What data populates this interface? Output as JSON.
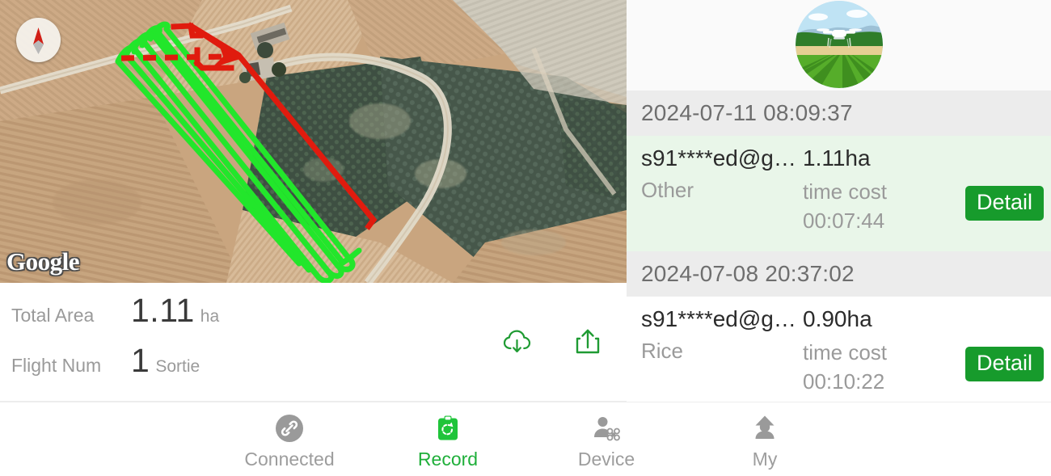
{
  "map": {
    "provider_logo": "Google",
    "compass_icon": "compass-needle-icon",
    "flight_path_color": "#22e62b",
    "boundary_color": "#e01b0e"
  },
  "summary": {
    "rows": [
      {
        "label": "Total Area",
        "value": "1.11",
        "unit": "ha"
      },
      {
        "label": "Flight Num",
        "value": "1",
        "unit": "Sortie"
      }
    ],
    "actions": [
      {
        "name": "cloud-download-icon",
        "label": "Download"
      },
      {
        "name": "share-upload-icon",
        "label": "Upload"
      }
    ],
    "action_color": "#1f9b33"
  },
  "records": {
    "avatar_icon": "drone-over-farmland-avatar",
    "items": [
      {
        "date": "2024-07-11 08:09:37",
        "user": "s91****ed@g…",
        "area": "1.11ha",
        "crop": "Other",
        "time_cost_label": "time cost",
        "time_cost": "00:07:44",
        "detail_label": "Detail",
        "selected": true
      },
      {
        "date": "2024-07-08 20:37:02",
        "user": "s91****ed@g…",
        "area": "0.90ha",
        "crop": "Rice",
        "time_cost_label": "time cost",
        "time_cost": "00:10:22",
        "detail_label": "Detail",
        "selected": false
      }
    ],
    "detail_button_color": "#179b2c",
    "selected_row_color": "#e9f6e9",
    "date_header_color": "#ececec"
  },
  "navbar": {
    "active_color": "#1faf3a",
    "inactive_color": "#9d9d9d",
    "items": [
      {
        "label": "Connected",
        "icon": "link-chain-icon",
        "active": false
      },
      {
        "label": "Record",
        "icon": "clipboard-refresh-icon",
        "active": true
      },
      {
        "label": "Device",
        "icon": "person-drone-icon",
        "active": false
      },
      {
        "label": "My",
        "icon": "person-up-arrow-icon",
        "active": false
      }
    ]
  }
}
